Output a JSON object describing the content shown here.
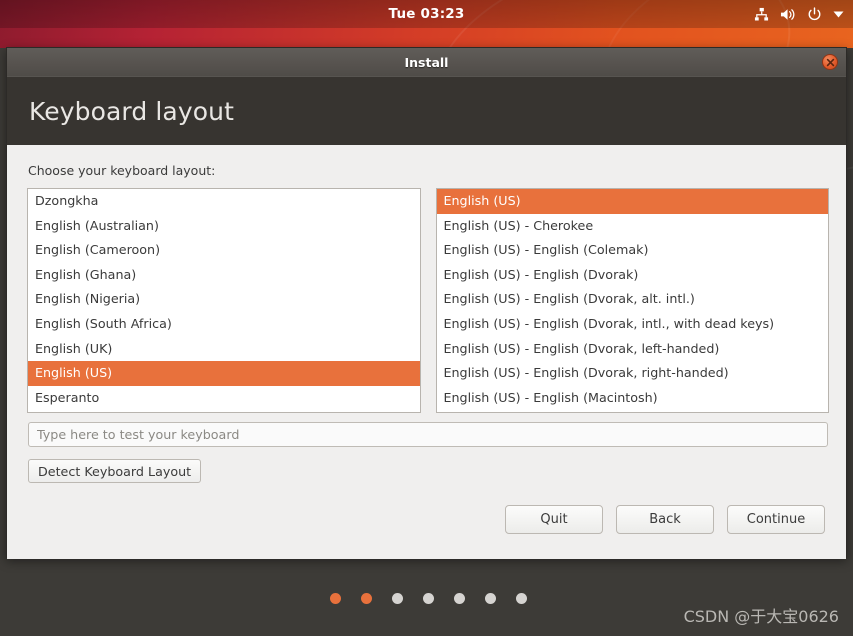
{
  "topbar": {
    "clock": "Tue 03:23",
    "indicators": [
      {
        "name": "network-icon",
        "label": "network"
      },
      {
        "name": "volume-icon",
        "label": "volume"
      },
      {
        "name": "power-icon",
        "label": "power"
      },
      {
        "name": "chevron-down-icon",
        "label": "system menu"
      }
    ]
  },
  "window": {
    "title": "Install",
    "close_label": "x"
  },
  "page": {
    "title": "Keyboard layout",
    "choose_label": "Choose your keyboard layout:"
  },
  "layout_list": {
    "selected": "English (US)",
    "items": [
      "Dzongkha",
      "English (Australian)",
      "English (Cameroon)",
      "English (Ghana)",
      "English (Nigeria)",
      "English (South Africa)",
      "English (UK)",
      "English (US)",
      "Esperanto"
    ]
  },
  "variant_list": {
    "selected": "English (US)",
    "items": [
      "English (US)",
      "English (US) - Cherokee",
      "English (US) - English (Colemak)",
      "English (US) - English (Dvorak)",
      "English (US) - English (Dvorak, alt. intl.)",
      "English (US) - English (Dvorak, intl., with dead keys)",
      "English (US) - English (Dvorak, left-handed)",
      "English (US) - English (Dvorak, right-handed)",
      "English (US) - English (Macintosh)"
    ]
  },
  "test_entry": {
    "placeholder": "Type here to test your keyboard",
    "value": ""
  },
  "buttons": {
    "detect": "Detect Keyboard Layout",
    "quit": "Quit",
    "back": "Back",
    "continue": "Continue"
  },
  "progress": {
    "total_dots": 7,
    "active_dots": 2
  },
  "watermark": "CSDN @于大宝0626",
  "colors": {
    "accent": "#e8713c",
    "header_dark": "#373430",
    "desktop": "#3d3b37",
    "window_bg": "#f0efee"
  }
}
